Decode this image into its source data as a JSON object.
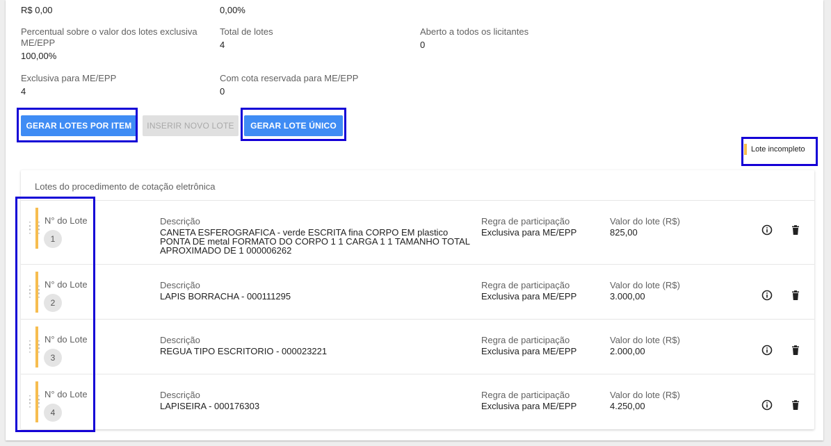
{
  "summary": {
    "top_left_value": "R$ 0,00",
    "top_mid_value": "0,00%",
    "pct_label": "Percentual sobre o valor dos lotes exclusiva ME/EPP",
    "pct_value": "100,00%",
    "total_label": "Total de lotes",
    "total_value": "4",
    "aberto_label": "Aberto a todos os licitantes",
    "aberto_value": "0",
    "exclusiva_label": "Exclusiva para ME/EPP",
    "exclusiva_value": "4",
    "cota_label": "Com cota reservada para ME/EPP",
    "cota_value": "0"
  },
  "buttons": {
    "gerar_por_item": "GERAR LOTES POR ITEM",
    "inserir_novo": "INSERIR NOVO LOTE",
    "gerar_unico": "GERAR LOTE ÚNICO"
  },
  "legend": {
    "label": "Lote incompleto",
    "color": "#f6bd50"
  },
  "lotes": {
    "title": "Lotes do procedimento de cotação eletrônica",
    "rows": [
      {
        "num_label": "N° do Lote",
        "num": "1",
        "desc_label": "Descrição",
        "desc": "CANETA ESFEROGRAFICA - verde ESCRITA fina CORPO EM plastico PONTA DE metal FORMATO DO CORPO 1 1 CARGA 1 1 TAMANHO TOTAL APROXIMADO DE 1 000006262",
        "regra_label": "Regra de participação",
        "regra": "Exclusiva para ME/EPP",
        "valor_label": "Valor do lote (R$)",
        "valor": "825,00"
      },
      {
        "num_label": "N° do Lote",
        "num": "2",
        "desc_label": "Descrição",
        "desc": "LAPIS BORRACHA - 000111295",
        "regra_label": "Regra de participação",
        "regra": "Exclusiva para ME/EPP",
        "valor_label": "Valor do lote (R$)",
        "valor": "3.000,00"
      },
      {
        "num_label": "N° do Lote",
        "num": "3",
        "desc_label": "Descrição",
        "desc": "REGUA TIPO ESCRITORIO - 000023221",
        "regra_label": "Regra de participação",
        "regra": "Exclusiva para ME/EPP",
        "valor_label": "Valor do lote (R$)",
        "valor": "2.000,00"
      },
      {
        "num_label": "N° do Lote",
        "num": "4",
        "desc_label": "Descrição",
        "desc": "LAPISEIRA - 000176303",
        "regra_label": "Regra de participação",
        "regra": "Exclusiva para ME/EPP",
        "valor_label": "Valor do lote (R$)",
        "valor": "4.250,00"
      }
    ]
  },
  "icons": {
    "info": "info-icon",
    "delete": "trash-icon",
    "drag": "drag-handle-icon"
  }
}
